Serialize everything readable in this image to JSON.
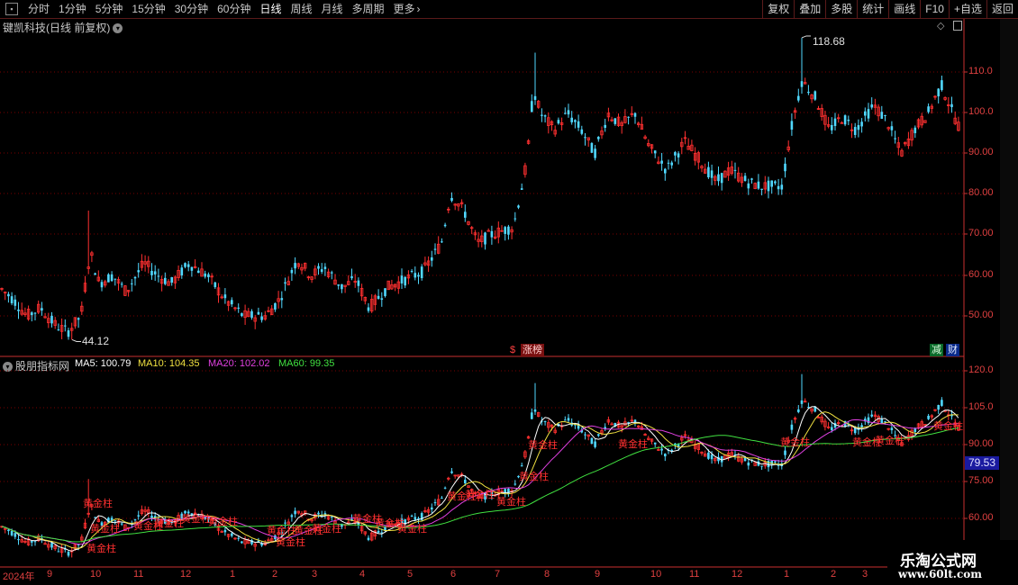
{
  "toolbar": {
    "periods": [
      "分时",
      "1分钟",
      "5分钟",
      "15分钟",
      "30分钟",
      "60分钟",
      "日线",
      "周线",
      "月线",
      "多周期",
      "更多"
    ],
    "active_period": "日线",
    "right_buttons": [
      "复权",
      "叠加",
      "多股",
      "统计",
      "画线",
      "F10",
      "+自选",
      "返回"
    ]
  },
  "main_panel": {
    "title": "键凯科技(日线 前复权)",
    "high_label": "118.68",
    "low_label": "44.12",
    "y_ticks": [
      "110.0",
      "100.0",
      "90.00",
      "80.00",
      "70.00",
      "60.00",
      "50.00"
    ],
    "markers": {
      "money_icon": "$",
      "zhangbang": "涨榜",
      "jian": "减",
      "cai": "财"
    }
  },
  "indicator_panel": {
    "title": "股朋指标网",
    "ma": [
      {
        "label": "MA5:",
        "value": "100.79",
        "color": "#ffffff"
      },
      {
        "label": "MA10:",
        "value": "104.35",
        "color": "#f0e040"
      },
      {
        "label": "MA20:",
        "value": "102.02",
        "color": "#e040e0"
      },
      {
        "label": "MA60:",
        "value": "99.35",
        "color": "#40e040"
      }
    ],
    "y_ticks": [
      "120.0",
      "105.0",
      "90.00",
      "75.00",
      "60.00"
    ],
    "price_tag": "79.53",
    "signal_label": "黄金柱"
  },
  "time_axis": {
    "labels": [
      "2024年",
      "9",
      "10",
      "11",
      "12",
      "1",
      "2",
      "3",
      "4",
      "5",
      "6",
      "7",
      "8",
      "9",
      "10",
      "11",
      "12",
      "1",
      "2",
      "3"
    ]
  },
  "watermark": {
    "name": "乐淘公式网",
    "url": "www.60lt.com"
  },
  "colors": {
    "up": "#ff3030",
    "down": "#50d8ff",
    "grid": "#7a0000",
    "axis": "#c83030"
  }
}
